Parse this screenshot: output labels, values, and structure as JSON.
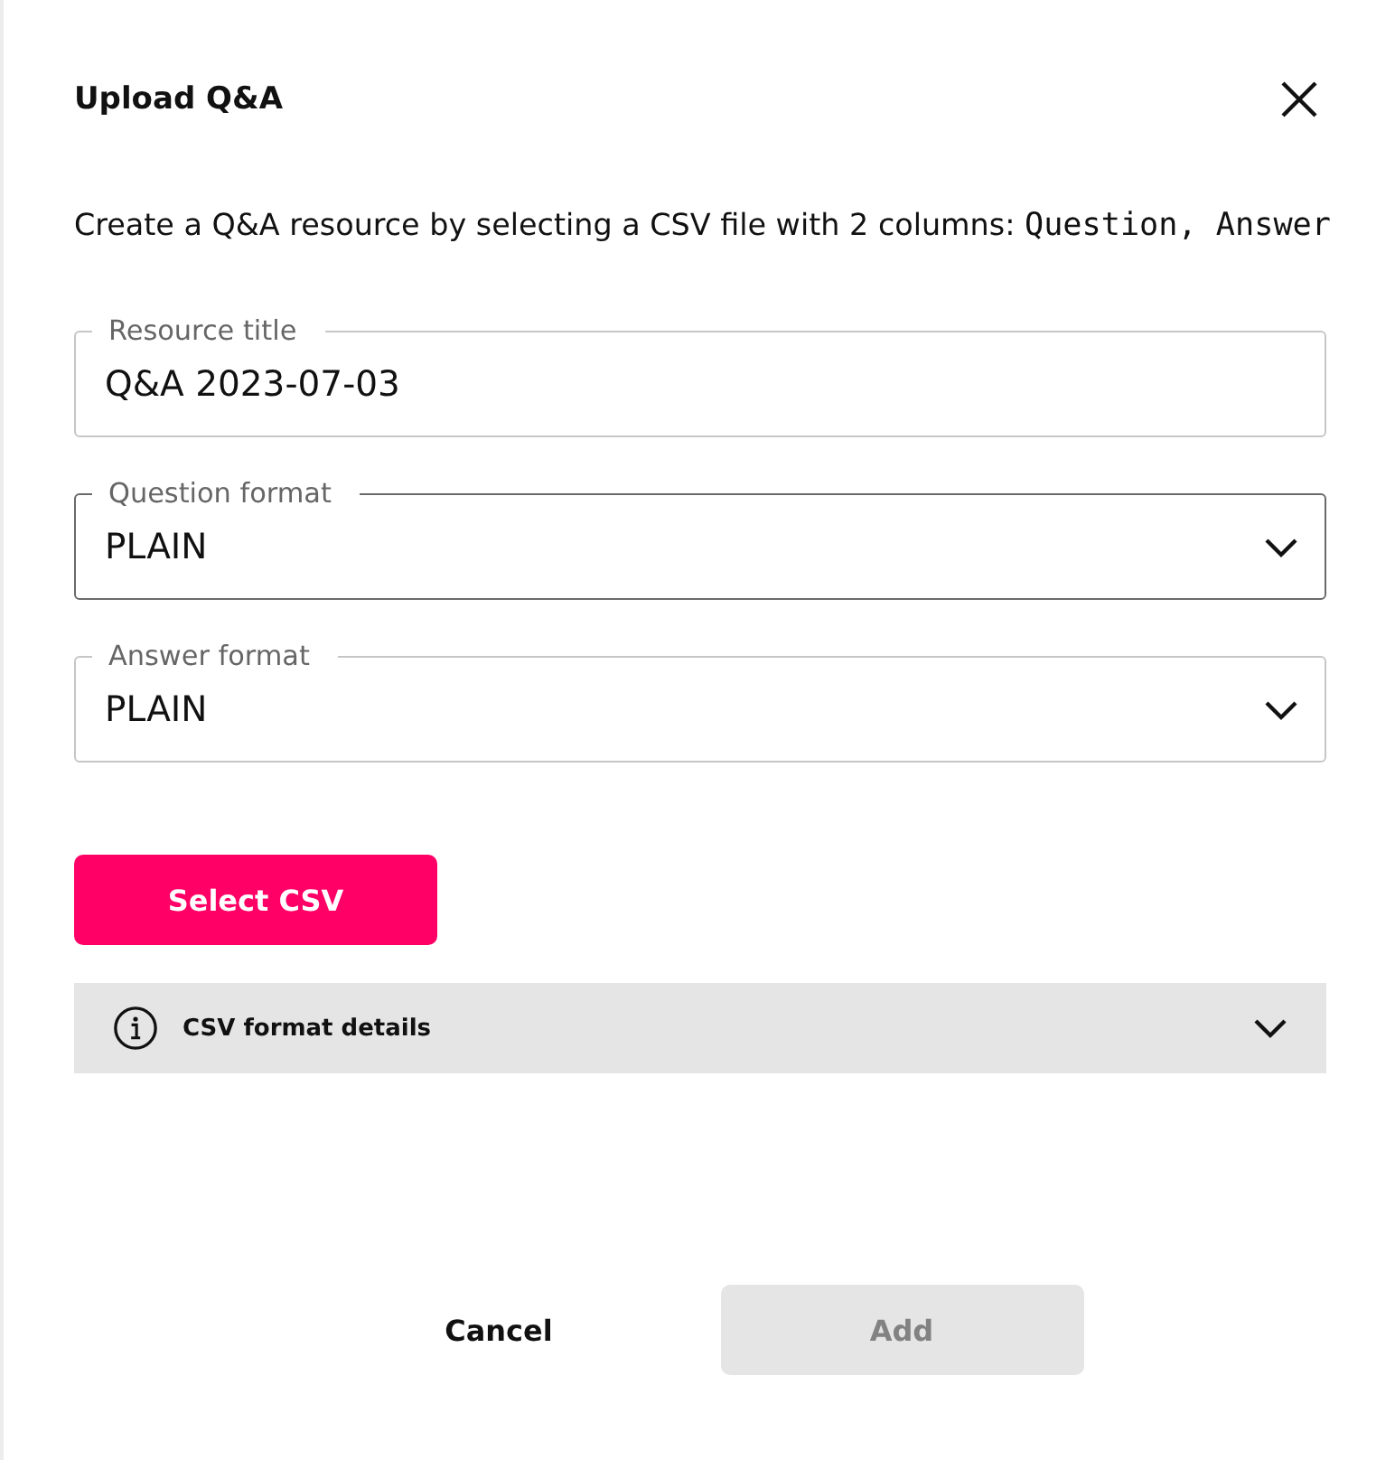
{
  "dialog": {
    "title": "Upload Q&A"
  },
  "description": {
    "text": "Create a Q&A resource by selecting a CSV file with 2 columns:",
    "code": "Question, Answer"
  },
  "fields": [
    {
      "kind": "text",
      "label": "Resource title",
      "value": "Q&A 2023-07-03",
      "focused": false
    },
    {
      "kind": "select",
      "label": "Question format",
      "value": "PLAIN",
      "focused": true
    },
    {
      "kind": "select",
      "label": "Answer format",
      "value": "PLAIN",
      "focused": false
    }
  ],
  "select_button": {
    "label": "Select CSV",
    "disabled": false
  },
  "details_panel": {
    "label": "CSV format details",
    "expanded": false
  },
  "footer_buttons": [
    {
      "label": "Cancel",
      "kind": "text",
      "disabled": false
    },
    {
      "label": "Add",
      "kind": "primary",
      "disabled": true
    }
  ]
}
